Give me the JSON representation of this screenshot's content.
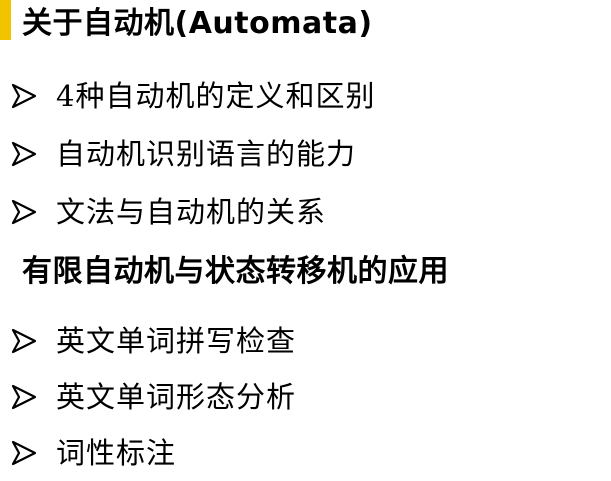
{
  "colors": {
    "accent": "#f2c400",
    "text": "#000000",
    "background": "#ffffff"
  },
  "sections": [
    {
      "heading": "关于自动机(Automata)",
      "bullet_icon": "arrow-bullet-icon",
      "items": [
        "4种自动机的定义和区别",
        "自动机识别语言的能力",
        "文法与自动机的关系"
      ]
    },
    {
      "heading": "有限自动机与状态转移机的应用",
      "bullet_icon": "arrow-bullet-icon",
      "items": [
        "英文单词拼写检查",
        "英文单词形态分析",
        "词性标注"
      ]
    }
  ]
}
